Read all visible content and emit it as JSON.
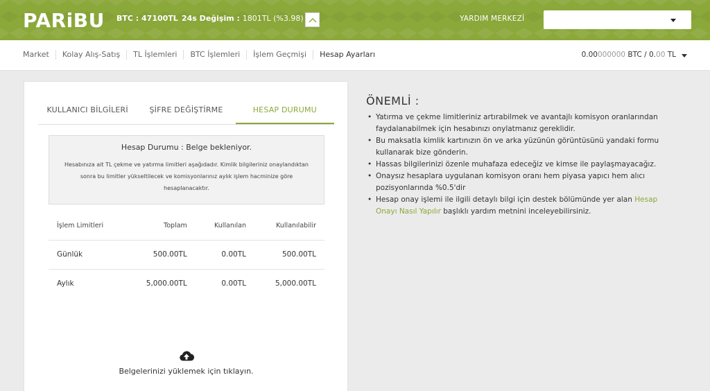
{
  "header": {
    "logo": "PARiBU",
    "btc_label": "BTC : 47100TL",
    "change_label": "24s Değişim : ",
    "change_value": "1801TL (%3.98)",
    "help_label": "YARDIM MERKEZİ",
    "select_value": ""
  },
  "nav": {
    "items": [
      "Market",
      "Kolay Alış-Satış",
      "TL İşlemleri",
      "BTC İşlemleri",
      "İşlem Geçmişi",
      "Hesap Ayarları"
    ],
    "active": "Hesap Ayarları"
  },
  "balance": {
    "btc_main": "0.00",
    "btc_dim": "000000",
    "btc_unit": " BTC / ",
    "tl_main": "0.",
    "tl_dim": "00",
    "tl_unit": " TL"
  },
  "tabs": [
    "KULLANICI BİLGİLERİ",
    "ŞİFRE DEĞİŞTİRME",
    "HESAP DURUMU"
  ],
  "status": {
    "title": "Hesap Durumu : Belge bekleniyor.",
    "description": "Hesabınıza ait TL çekme ve yatırma limitleri aşağıdadır. Kimlik bilgileriniz onaylandıktan sonra bu limitler yükseltilecek ve komisyonlarınız aylık işlem hacminize göre hesaplanacaktır."
  },
  "limits": {
    "headers": [
      "İşlem Limitleri",
      "Toplam",
      "Kullanılan",
      "Kullanılabilir"
    ],
    "rows": [
      [
        "Günlük",
        "500.00TL",
        "0.00TL",
        "500.00TL"
      ],
      [
        "Aylık",
        "5,000.00TL",
        "0.00TL",
        "5,000.00TL"
      ]
    ]
  },
  "upload": {
    "icon": "cloud-upload-icon",
    "label": "Belgelerinizi yüklemek için tıklayın."
  },
  "info": {
    "title": "ÖNEMLİ :",
    "items": [
      "Yatırma ve çekme limitleriniz artırabilmek ve avantajlı komisyon oranlarından faydalanabilmek için hesabınızı onylatmanız gereklidir.",
      "Bu maksatla kimlik kartınızın ön ve arka yüzünün görüntüsünü yandaki formu kullanarak bize gönderin.",
      "Hassas bilgilerinizi özenle muhafaza edeceğiz ve kimse ile paylaşmayacağız.",
      "Onaysız hesaplara uygulanan komisyon oranı hem piyasa yapıcı hem alıcı pozisyonlarında %0.5'dir"
    ],
    "last_prefix": "Hesap onay işlemi ile ilgili detaylı bilgi için destek bölümünde yer alan ",
    "last_link": "Hesap Onayı Nasıl Yapılır",
    "last_suffix": " başlıklı yardım metnini inceleyebilirsiniz."
  },
  "colors": {
    "brand": "#8ba83a",
    "background": "#ebebeb"
  }
}
